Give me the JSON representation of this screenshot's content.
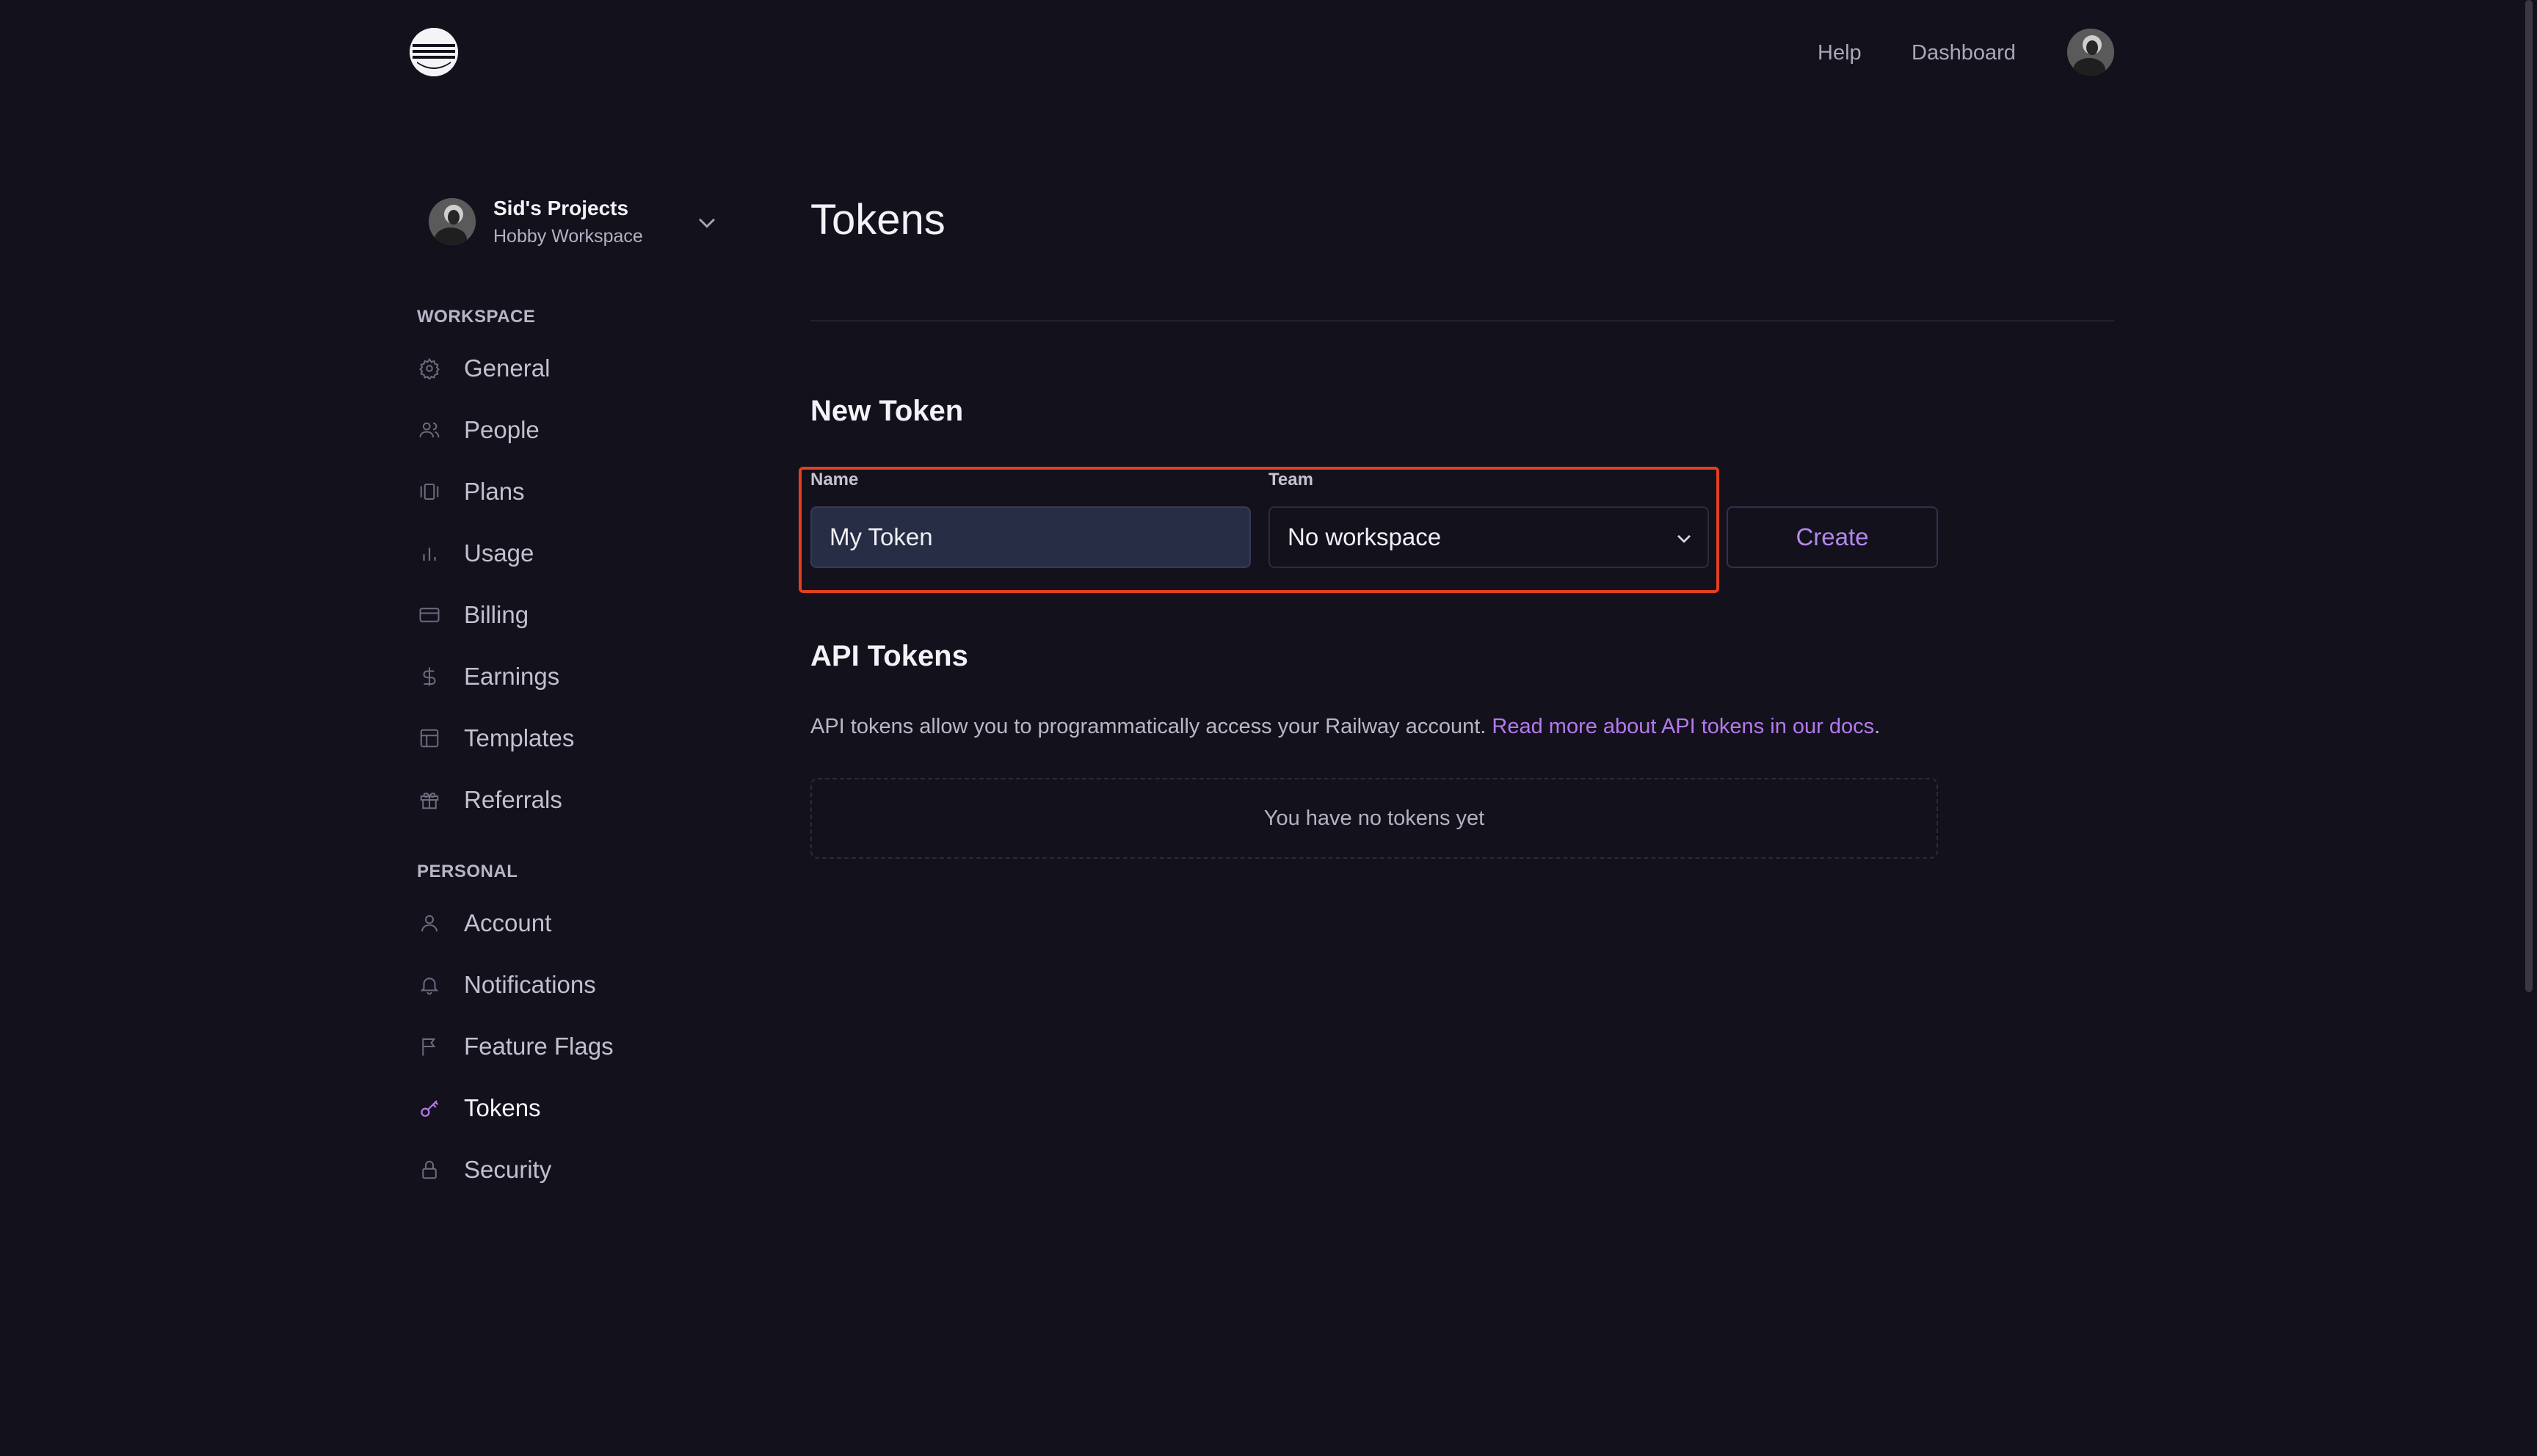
{
  "header": {
    "help": "Help",
    "dashboard": "Dashboard"
  },
  "workspace": {
    "name": "Sid's Projects",
    "subtitle": "Hobby Workspace"
  },
  "sidebar": {
    "workspace_label": "WORKSPACE",
    "workspace_items": [
      {
        "label": "General",
        "icon": "gear-icon"
      },
      {
        "label": "People",
        "icon": "people-icon"
      },
      {
        "label": "Plans",
        "icon": "plans-icon"
      },
      {
        "label": "Usage",
        "icon": "bar-chart-icon"
      },
      {
        "label": "Billing",
        "icon": "credit-card-icon"
      },
      {
        "label": "Earnings",
        "icon": "dollar-icon"
      },
      {
        "label": "Templates",
        "icon": "template-icon"
      },
      {
        "label": "Referrals",
        "icon": "gift-icon"
      }
    ],
    "personal_label": "PERSONAL",
    "personal_items": [
      {
        "label": "Account",
        "icon": "user-icon"
      },
      {
        "label": "Notifications",
        "icon": "bell-icon"
      },
      {
        "label": "Feature Flags",
        "icon": "flag-icon"
      },
      {
        "label": "Tokens",
        "icon": "key-icon",
        "active": true
      },
      {
        "label": "Security",
        "icon": "lock-icon"
      }
    ]
  },
  "main": {
    "title": "Tokens",
    "new_token": {
      "heading": "New Token",
      "name_label": "Name",
      "name_value": "My Token",
      "team_label": "Team",
      "team_value": "No workspace",
      "create_label": "Create"
    },
    "api_tokens": {
      "heading": "API Tokens",
      "description": "API tokens allow you to programmatically access your Railway account. ",
      "docs_link": "Read more about API tokens in our docs",
      "period": ".",
      "empty": "You have no tokens yet"
    }
  },
  "colors": {
    "background": "#13111c",
    "accent": "#b479ec",
    "highlight": "#e2401f"
  }
}
